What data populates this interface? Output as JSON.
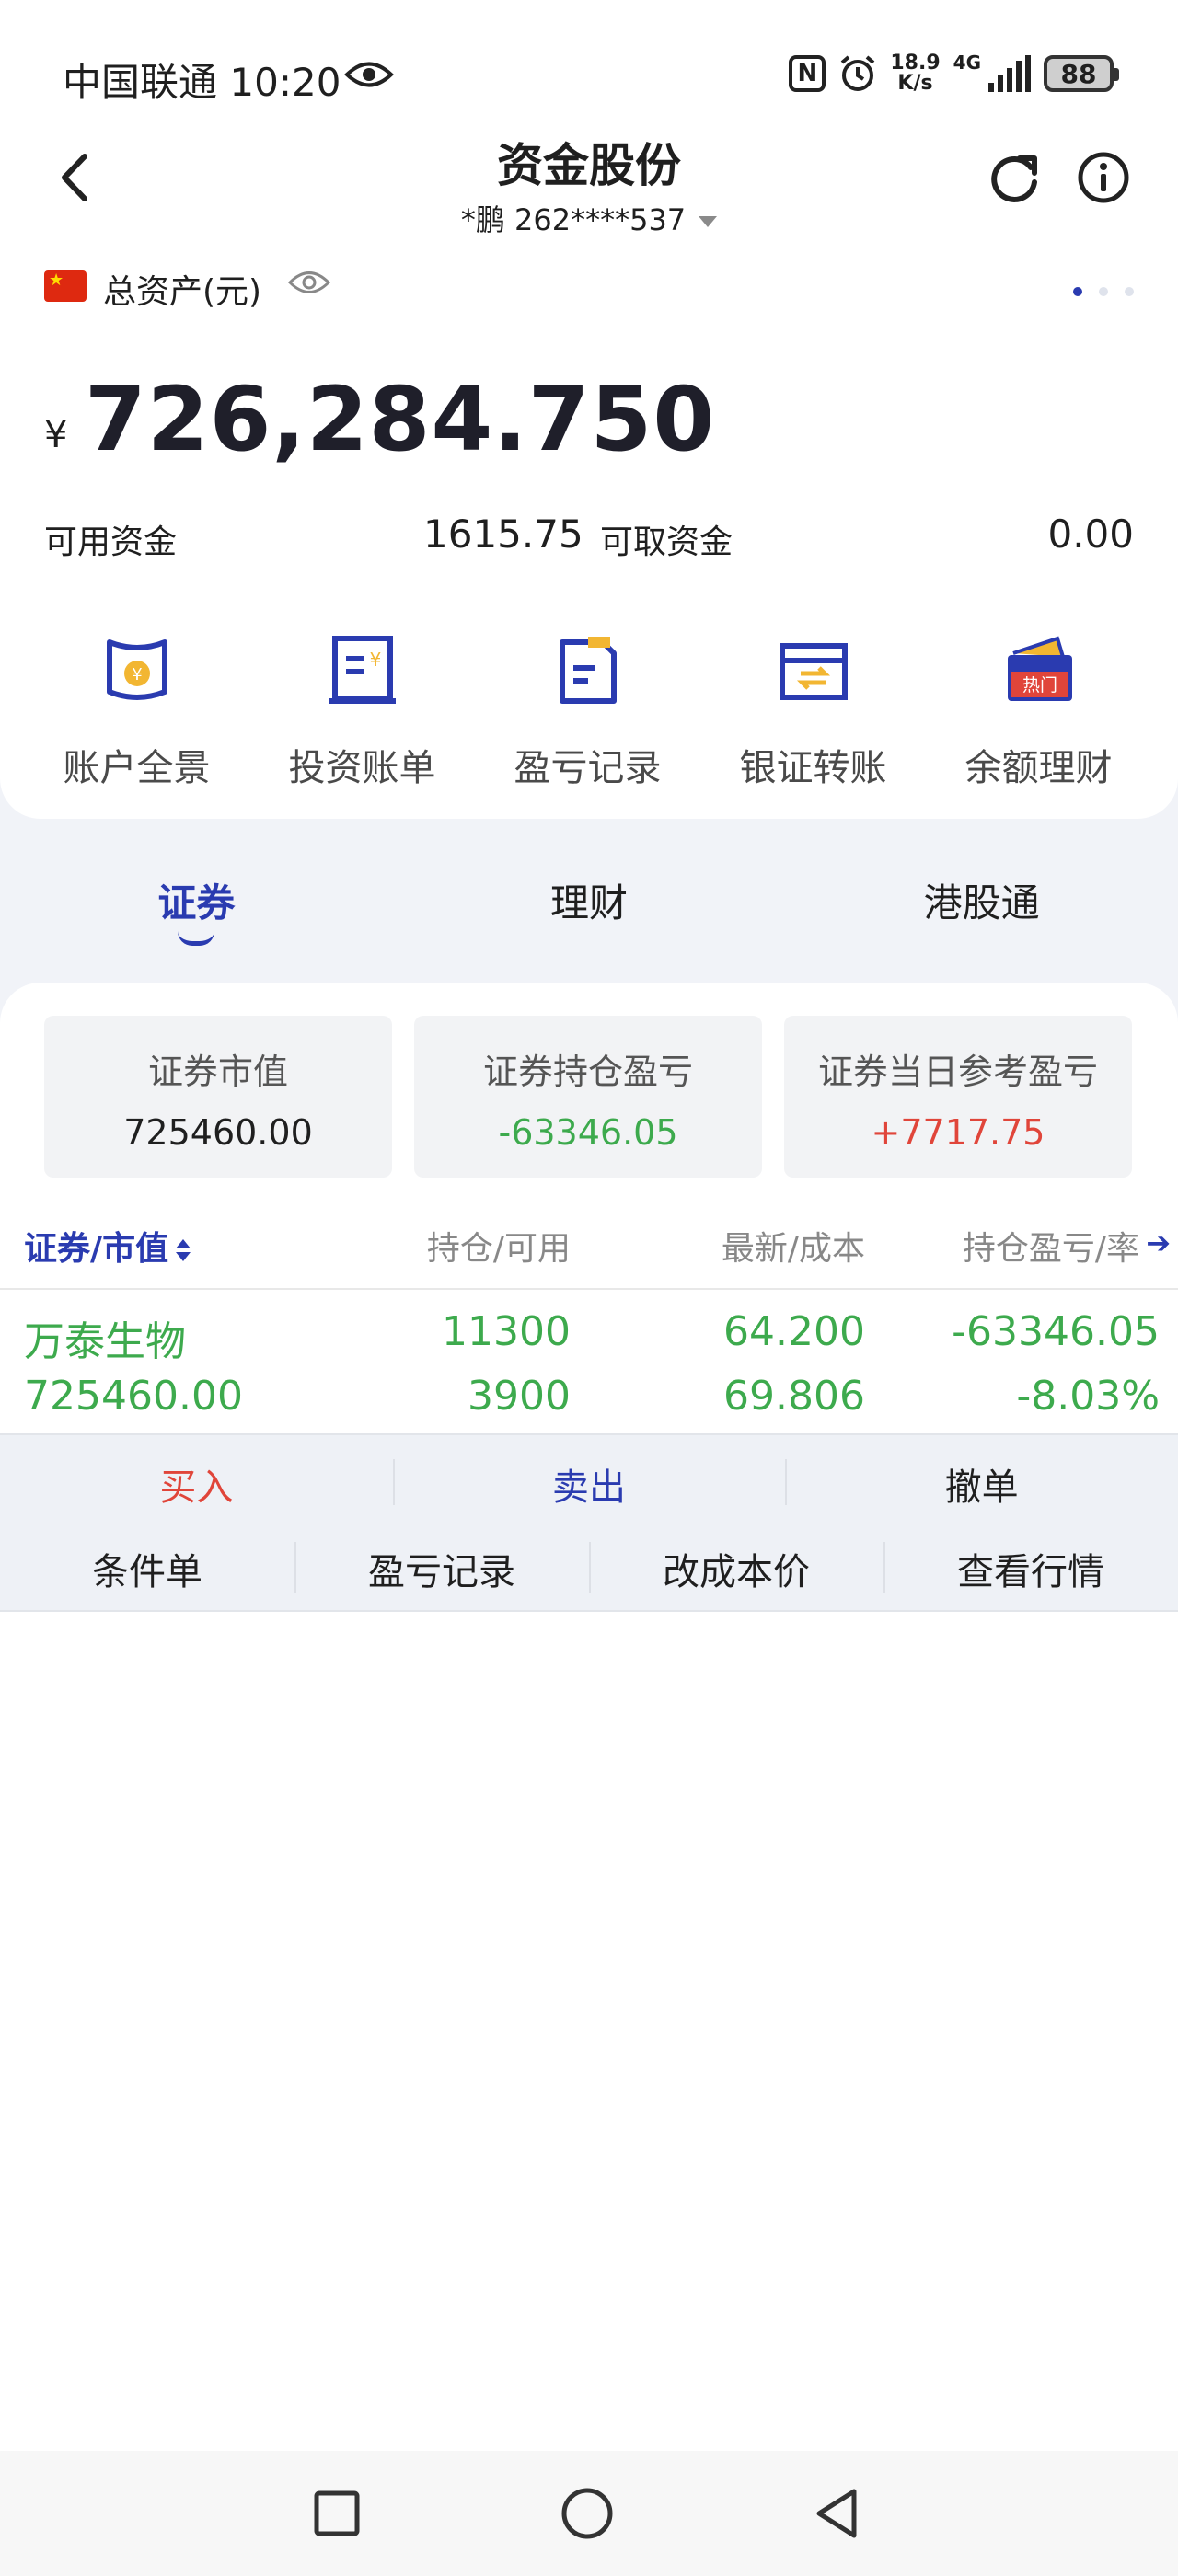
{
  "status_bar": {
    "carrier": "中国联通",
    "time": "10:20",
    "net_speed_top": "18.9",
    "net_speed_bottom": "K/s",
    "network": "4G",
    "battery": "88"
  },
  "header": {
    "title": "资金股份",
    "account": "*鹏 262****537"
  },
  "assets": {
    "total_label": "总资产(元)",
    "currency_symbol": "¥",
    "total_value": "726,284.750",
    "available_label": "可用资金",
    "available_value": "1615.75",
    "withdrawable_label": "可取资金",
    "withdrawable_value": "0.00"
  },
  "actions": [
    {
      "label": "账户全景",
      "icon": "account-overview-icon"
    },
    {
      "label": "投资账单",
      "icon": "investment-bill-icon"
    },
    {
      "label": "盈亏记录",
      "icon": "pnl-record-icon"
    },
    {
      "label": "银证转账",
      "icon": "bank-transfer-icon"
    },
    {
      "label": "余额理财",
      "icon": "balance-wealth-icon",
      "badge": "热门"
    }
  ],
  "tabs": [
    {
      "label": "证券",
      "active": true
    },
    {
      "label": "理财",
      "active": false
    },
    {
      "label": "港股通",
      "active": false
    }
  ],
  "summary": [
    {
      "label": "证券市值",
      "value": "725460.00"
    },
    {
      "label": "证券持仓盈亏",
      "value": "-63346.05"
    },
    {
      "label": "证券当日参考盈亏",
      "value": "+7717.75"
    }
  ],
  "table": {
    "columns": [
      "证券/市值",
      "持仓/可用",
      "最新/成本",
      "持仓盈亏/率"
    ],
    "rows": [
      {
        "name": "万泰生物",
        "market_value": "725460.00",
        "position": "11300",
        "available": "3900",
        "latest": "64.200",
        "cost": "69.806",
        "pnl": "-63346.05",
        "pnl_rate": "-8.03%"
      }
    ]
  },
  "operations": {
    "row1": [
      "买入",
      "卖出",
      "撤单"
    ],
    "row2": [
      "条件单",
      "盈亏记录",
      "改成本价",
      "查看行情"
    ]
  },
  "colors": {
    "accent": "#2a3bb0",
    "loss_green": "#3daa4d",
    "gain_red": "#e0453a"
  }
}
